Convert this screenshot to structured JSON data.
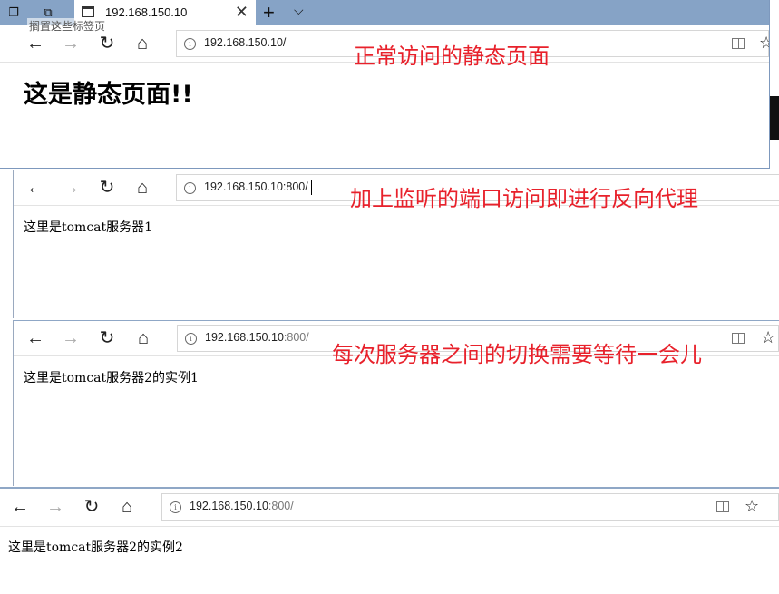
{
  "tabbar": {
    "tab_title": "192.168.150.10",
    "tooltip": "搁置这些标签页",
    "close_glyph": "✕",
    "newtab_glyph": "+",
    "tablist_glyph": "⌵"
  },
  "icons": {
    "back": "←",
    "forward": "→",
    "refresh": "↻",
    "home": "⌂",
    "info": "i",
    "star": "☆"
  },
  "windows": [
    {
      "url_host": "192.168.150.10/",
      "url_port": "",
      "annotation": "正常访问的静态页面",
      "content": "这是静态页面!!"
    },
    {
      "url_host": "192.168.150.10:800/",
      "url_port": "",
      "annotation": "加上监听的端口访问即进行反向代理",
      "content": "这里是tomcat服务器1"
    },
    {
      "url_host": "192.168.150.10",
      "url_port": ":800/",
      "annotation": "每次服务器之间的切换需要等待一会儿",
      "content": "这里是tomcat服务器2的实例1"
    },
    {
      "url_host": "192.168.150.10",
      "url_port": ":800/",
      "annotation": "",
      "content": "这里是tomcat服务器2的实例2"
    }
  ],
  "colors": {
    "annotation": "#e8212b",
    "tabbar": "#86a3c6"
  }
}
